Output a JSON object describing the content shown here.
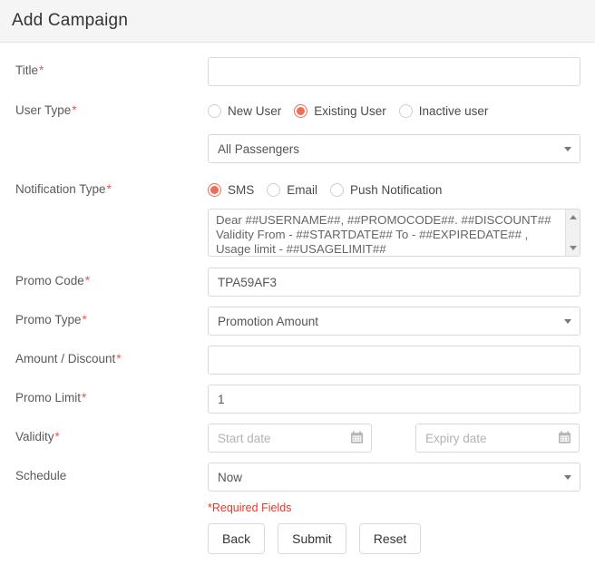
{
  "header": {
    "title": "Add Campaign"
  },
  "form": {
    "title_field": {
      "label": "Title",
      "required": "*",
      "value": "",
      "placeholder": ""
    },
    "user_type": {
      "label": "User Type",
      "required": "*",
      "options": [
        {
          "label": "New User",
          "selected": false
        },
        {
          "label": "Existing User",
          "selected": true
        },
        {
          "label": "Inactive user",
          "selected": false
        }
      ]
    },
    "audience_select": {
      "value": "All Passengers",
      "caret_icon": "chevron-down-icon"
    },
    "notification_type": {
      "label": "Notification Type",
      "required": "*",
      "options": [
        {
          "label": "SMS",
          "selected": true
        },
        {
          "label": "Email",
          "selected": false
        },
        {
          "label": "Push Notification",
          "selected": false
        }
      ]
    },
    "message_template": {
      "line1": "Dear ##USERNAME##, ##PROMOCODE##. ##DISCOUNT##",
      "line2": "Validity From - ##STARTDATE## To - ##EXPIREDATE## ,",
      "line3": "Usage limit - ##USAGELIMIT##",
      "scroll_up_icon": "scroll-up-arrow-icon",
      "scroll_down_icon": "scroll-down-arrow-icon"
    },
    "promo_code": {
      "label": "Promo Code",
      "required": "*",
      "value": "TPA59AF3"
    },
    "promo_type": {
      "label": "Promo Type",
      "required": "*",
      "value": "Promotion Amount",
      "caret_icon": "chevron-down-icon"
    },
    "amount_discount": {
      "label": "Amount / Discount",
      "required": "*",
      "value": "",
      "placeholder": ""
    },
    "promo_limit": {
      "label": "Promo Limit",
      "required": "*",
      "value": "1"
    },
    "validity": {
      "label": "Validity",
      "required": "*",
      "start_placeholder": "Start date",
      "start_value": "",
      "expiry_placeholder": "Expiry date",
      "expiry_value": "",
      "calendar_icon": "calendar-icon"
    },
    "schedule": {
      "label": "Schedule",
      "value": "Now",
      "caret_icon": "chevron-down-icon"
    }
  },
  "footer": {
    "required_note": "*Required Fields",
    "back_label": "Back",
    "submit_label": "Submit",
    "reset_label": "Reset"
  },
  "colors": {
    "accent": "#ef6c55",
    "required_red": "#e8372b",
    "header_bg": "#f5f5f5",
    "border": "#d9d9d9"
  }
}
